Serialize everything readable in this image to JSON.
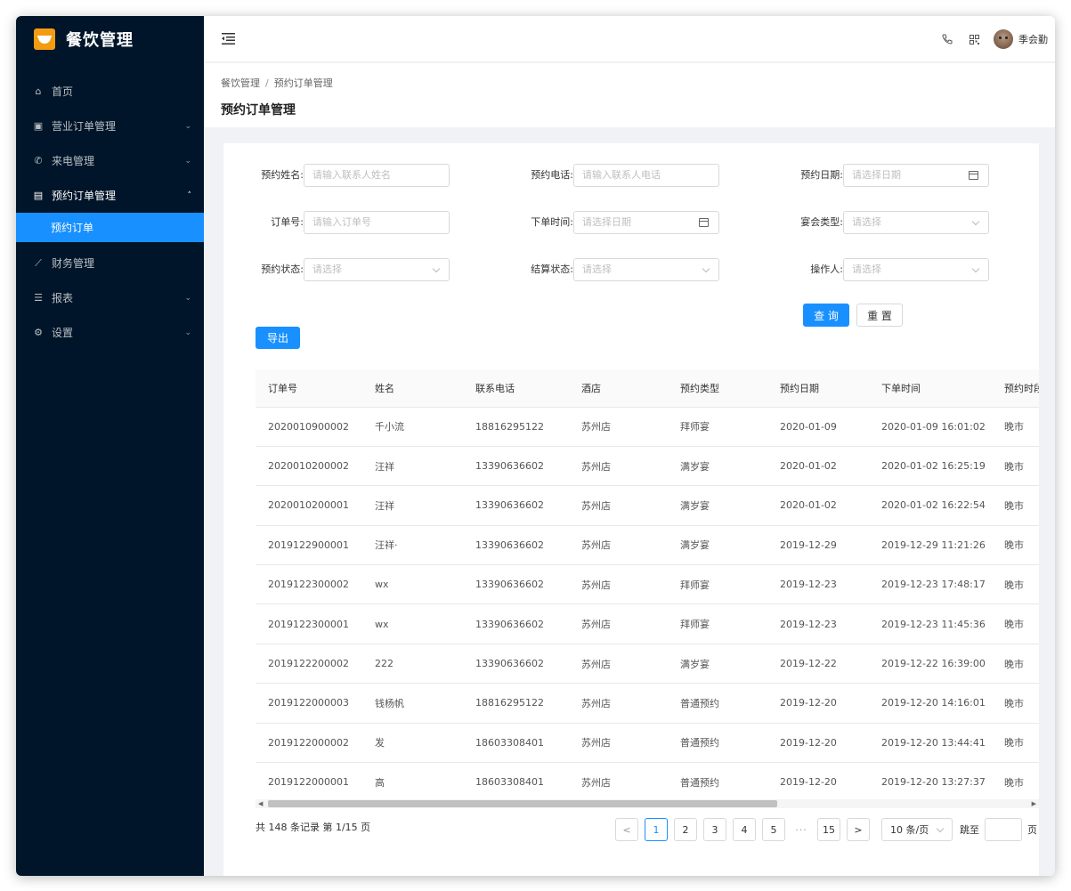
{
  "app": {
    "title": "餐饮管理"
  },
  "sidebar": {
    "items": [
      {
        "label": "首页",
        "icon": "home-icon",
        "glyph": "⌂",
        "arrow": ""
      },
      {
        "label": "营业订单管理",
        "icon": "order-icon",
        "glyph": "▣",
        "arrow": "⌄"
      },
      {
        "label": "来电管理",
        "icon": "phone-icon",
        "glyph": "✆",
        "arrow": "⌄"
      },
      {
        "label": "预约订单管理",
        "icon": "booking-icon",
        "glyph": "▤",
        "arrow": "˄"
      },
      {
        "label": "财务管理",
        "icon": "chart-icon",
        "glyph": "⟋",
        "arrow": ""
      },
      {
        "label": "报表",
        "icon": "list-icon",
        "glyph": "☰",
        "arrow": "⌄"
      },
      {
        "label": "设置",
        "icon": "gear-icon",
        "glyph": "⚙",
        "arrow": "⌄"
      }
    ],
    "sub_active": "预约订单"
  },
  "header": {
    "username": "季会勤"
  },
  "breadcrumb": {
    "root": "餐饮管理",
    "sep": "/",
    "current": "预约订单管理"
  },
  "page": {
    "title": "预约订单管理"
  },
  "filters": {
    "name": {
      "label": "预约姓名:",
      "placeholder": "请输入联系人姓名"
    },
    "phone": {
      "label": "预约电话:",
      "placeholder": "请输入联系人电话"
    },
    "date": {
      "label": "预约日期:",
      "placeholder": "请选择日期"
    },
    "order_no": {
      "label": "订单号:",
      "placeholder": "请输入订单号"
    },
    "order_time": {
      "label": "下单时间:",
      "placeholder": "请选择日期"
    },
    "banquet_type": {
      "label": "宴会类型:",
      "placeholder": "请选择"
    },
    "status": {
      "label": "预约状态:",
      "placeholder": "请选择"
    },
    "settle_status": {
      "label": "结算状态:",
      "placeholder": "请选择"
    },
    "operator": {
      "label": "操作人:",
      "placeholder": "请选择"
    }
  },
  "buttons": {
    "query": "查 询",
    "reset": "重 置",
    "export": "导出"
  },
  "table": {
    "columns": [
      "订单号",
      "姓名",
      "联系电话",
      "酒店",
      "预约类型",
      "预约日期",
      "下单时间",
      "预约时段"
    ],
    "rows": [
      [
        "2020010900002",
        "千小流",
        "18816295122",
        "苏州店",
        "拜师宴",
        "2020-01-09",
        "2020-01-09 16:01:02",
        "晚市"
      ],
      [
        "2020010200002",
        "汪祥",
        "13390636602",
        "苏州店",
        "满岁宴",
        "2020-01-02",
        "2020-01-02 16:25:19",
        "晚市"
      ],
      [
        "2020010200001",
        "汪祥",
        "13390636602",
        "苏州店",
        "满岁宴",
        "2020-01-02",
        "2020-01-02 16:22:54",
        "晚市"
      ],
      [
        "2019122900001",
        "汪祥·",
        "13390636602",
        "苏州店",
        "满岁宴",
        "2019-12-29",
        "2019-12-29 11:21:26",
        "晚市"
      ],
      [
        "2019122300002",
        "wx",
        "13390636602",
        "苏州店",
        "拜师宴",
        "2019-12-23",
        "2019-12-23 17:48:17",
        "晚市"
      ],
      [
        "2019122300001",
        "wx",
        "13390636602",
        "苏州店",
        "拜师宴",
        "2019-12-23",
        "2019-12-23 11:45:36",
        "晚市"
      ],
      [
        "2019122200002",
        "222",
        "13390636602",
        "苏州店",
        "满岁宴",
        "2019-12-22",
        "2019-12-22 16:39:00",
        "晚市"
      ],
      [
        "2019122000003",
        "钱杨帆",
        "18816295122",
        "苏州店",
        "普通预约",
        "2019-12-20",
        "2019-12-20 14:16:01",
        "晚市"
      ],
      [
        "2019122000002",
        "发",
        "18603308401",
        "苏州店",
        "普通预约",
        "2019-12-20",
        "2019-12-20 13:44:41",
        "晚市"
      ],
      [
        "2019122000001",
        "高",
        "18603308401",
        "苏州店",
        "普通预约",
        "2019-12-20",
        "2019-12-20 13:27:37",
        "晚市"
      ]
    ]
  },
  "pagination": {
    "total_text": "共 148 条记录 第 1/15 页",
    "pages": [
      "1",
      "2",
      "3",
      "4",
      "5"
    ],
    "ellipsis": "···",
    "last": "15",
    "prev": "<",
    "next": ">",
    "page_size": "10 条/页",
    "jump_label": "跳至",
    "page_suffix": "页"
  },
  "colors": {
    "sidebar_bg": "#001529",
    "accent": "#1890ff",
    "logo": "#f39c12"
  }
}
